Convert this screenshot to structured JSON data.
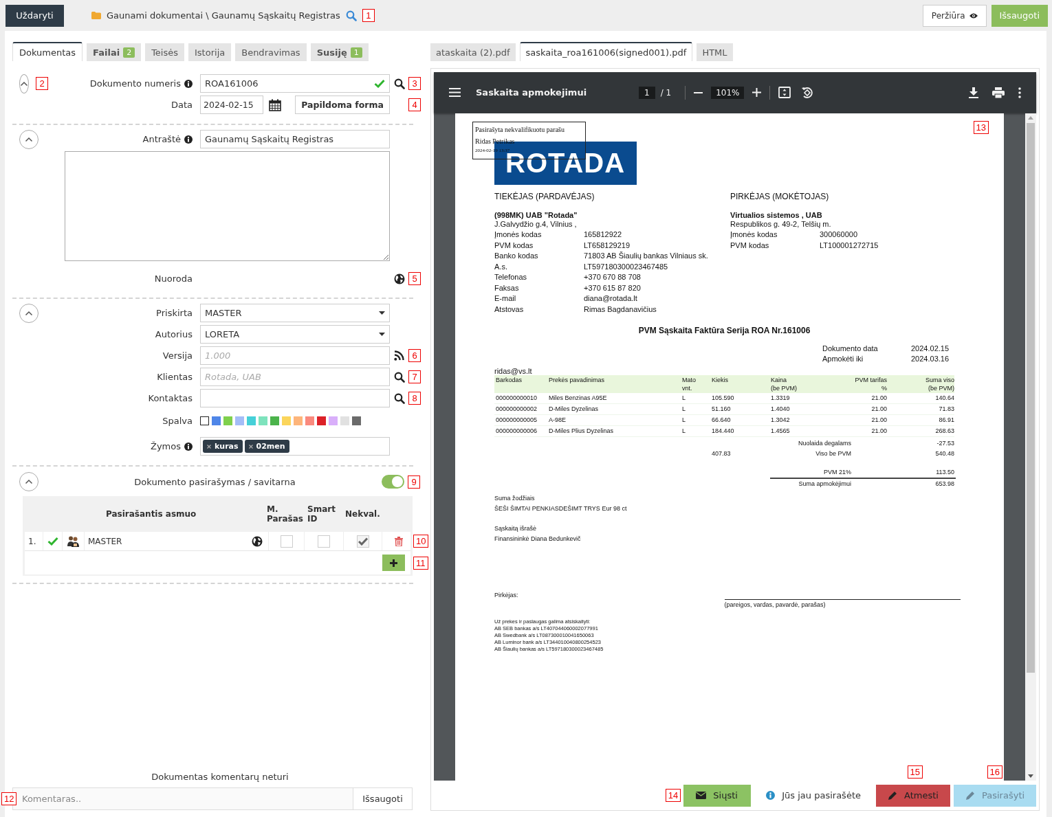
{
  "top_bar": {
    "close_button": "Uždaryti",
    "breadcrumb": "Gaunami dokumentai \\ Gaunamų Sąskaitų Registras",
    "preview_button": "Peržiūra",
    "save_button": "Išsaugoti"
  },
  "callouts": [
    "1",
    "2",
    "3",
    "4",
    "5",
    "6",
    "7",
    "8",
    "9",
    "10",
    "11",
    "12",
    "13",
    "14",
    "15",
    "16"
  ],
  "tabs": [
    {
      "label": "Dokumentas",
      "selected": true
    },
    {
      "label": "Failai",
      "badge": "2",
      "selected": false
    },
    {
      "label": "Teisės",
      "selected": false
    },
    {
      "label": "Istorija",
      "selected": false
    },
    {
      "label": "Bendravimas",
      "selected": false
    },
    {
      "label": "Susiję",
      "badge": "1",
      "selected": false
    }
  ],
  "document_number": {
    "label": "Dokumento numeris",
    "value": "ROA161006",
    "valid": true
  },
  "date": {
    "label": "Data",
    "value": "2024-02-15"
  },
  "extra_form_button": "Papildoma forma",
  "title_field": {
    "label": "Antraštė",
    "value": "Gaunamų Sąskaitų Registras"
  },
  "link_label": "Nuoroda",
  "fields": [
    {
      "kind": "select",
      "label": "Priskirta",
      "value": "MASTER"
    },
    {
      "kind": "select",
      "label": "Autorius",
      "value": "LORETA"
    },
    {
      "kind": "feed",
      "label": "Versija",
      "placeholder": "1.000"
    },
    {
      "kind": "lookup",
      "label": "Klientas",
      "placeholder": "Rotada, UAB"
    },
    {
      "kind": "lookup",
      "label": "Kontaktas"
    }
  ],
  "color_picker": {
    "label": "Spalva",
    "swatches": [
      {
        "color": "#ffffff"
      },
      {
        "color": "#4f86e8"
      },
      {
        "color": "#7fd04c"
      },
      {
        "color": "#a4bdf7"
      },
      {
        "color": "#46d0d8"
      },
      {
        "color": "#7ee3bd"
      },
      {
        "color": "#4bb34b"
      },
      {
        "color": "#fbd55b"
      },
      {
        "color": "#fdb57b"
      },
      {
        "color": "#fa8a7e"
      },
      {
        "color": "#dc2128"
      },
      {
        "color": "#d9affa"
      },
      {
        "color": "#e1e1e1"
      },
      {
        "color": "#6b6b6b"
      }
    ]
  },
  "tags": {
    "label": "Žymos",
    "items": [
      "kuras",
      "02men"
    ]
  },
  "signing": {
    "title": "Dokumento pasirašymas / savitarna",
    "enabled": true,
    "columns": [
      "Pasirašantis asmuo",
      "M. Parašas",
      "Smart ID",
      "Nekval."
    ],
    "rows": [
      {
        "index": "1.",
        "signed": true,
        "name": "MASTER",
        "m_signature": false,
        "smart_id": false,
        "unqualified": true
      }
    ]
  },
  "comments": {
    "empty_text": "Dokumentas komentarų neturi",
    "placeholder": "Komentaras..",
    "save_button": "Išsaugoti"
  },
  "file_tabs": [
    {
      "label": "ataskaita (2).pdf",
      "selected": false
    },
    {
      "label": "saskaita_roa161006(signed001).pdf",
      "selected": true
    },
    {
      "label": "HTML",
      "selected": false
    }
  ],
  "viewer": {
    "title": "Saskaita apmokejimui",
    "page": "1",
    "page_count": "/ 1",
    "zoom": "101%"
  },
  "document": {
    "stamp": [
      "Pasirašyta nekvalifikuotu parašu",
      "Ridas Petrikas",
      "2024-02-19 13:37"
    ],
    "logo": "ROTADA",
    "supplier": {
      "heading": "TIEKĖJAS (PARDAVĖJAS)",
      "name": "(998MK) UAB \"Rotada\"",
      "address": "J.Galvydžio g.4, Vilnius ,",
      "details": [
        {
          "key": "Įmonės kodas",
          "value": "165812922"
        },
        {
          "key": "PVM kodas",
          "value": "LT658129219"
        },
        {
          "key": "Banko kodas",
          "value": "71803 AB Šiaulių bankas Vilniaus sk."
        },
        {
          "key": "A.s.",
          "value": "LT597180300023467485"
        },
        {
          "key": "Telefonas",
          "value": "+370 670 88 708"
        },
        {
          "key": "Faksas",
          "value": "+370 615 87 820"
        },
        {
          "key": "E-mail",
          "value": "diana@rotada.lt"
        },
        {
          "key": "Atstovas",
          "value": "Rimas Bagdanavičius"
        }
      ]
    },
    "buyer": {
      "heading": "PIRKĖJAS (MOKĖTOJAS)",
      "name": "Virtualios sistemos , UAB",
      "address": "Respublikos g. 49-2, Telšių m.",
      "details": [
        {
          "key": "Įmonės kodas",
          "value": "300060000"
        },
        {
          "key": "PVM kodas",
          "value": "LT100001272715"
        }
      ]
    },
    "title": "PVM Sąskaita Faktūra Serija ROA Nr.161006",
    "dates": [
      {
        "key": "Dokumento data",
        "value": "2024.02.15"
      },
      {
        "key": "Apmokėti iki",
        "value": "2024.03.16"
      }
    ],
    "email": "ridas@vs.lt",
    "columns": [
      "Barkodas",
      "Prekės pavadinimas",
      "Mato\nvnt.",
      "Kiekis",
      "Kaina\n(be PVM)",
      "PVM tarifas\n%",
      "Suma viso\n(be PVM)"
    ],
    "rows": [
      [
        "000000000010",
        "Miles Benzinas A95E",
        "L",
        "105.590",
        "1.3319",
        "21.00",
        "140.64"
      ],
      [
        "000000000002",
        "D-Miles Dyzelinas",
        "L",
        "51.160",
        "1.4040",
        "21.00",
        "71.83"
      ],
      [
        "000000000005",
        "A-98E",
        "L",
        "66.640",
        "1.3042",
        "21.00",
        "86.91"
      ],
      [
        "000000000006",
        "D-Miles Plius Dyzelinas",
        "L",
        "184.440",
        "1.4565",
        "21.00",
        "268.63"
      ]
    ],
    "totals": [
      {
        "kind": "discount",
        "label": "Nuolaida degalams",
        "value": "-27.53"
      },
      {
        "kind": "subtotal",
        "quantity": "407.83",
        "label": "Viso be PVM",
        "value": "540.48"
      },
      {
        "kind": "vat",
        "label": "PVM 21%",
        "value": "113.50"
      },
      {
        "kind": "total",
        "label": "Suma apmokėjimui",
        "value": "653.98"
      }
    ],
    "amount_in_words": {
      "label": "Suma žodžiais",
      "value": "ŠEŠI ŠIMTAI PENKIASDEŠIMT TRYS Eur 98 ct"
    },
    "issuer": {
      "label": "Sąskaitą išrašė",
      "value": "Finansininkė Diana Bedunkevič"
    },
    "buyer_signature": {
      "label": "Pirkėjas:",
      "caption": "(pareigos, vardas, pavardė, parašas)"
    },
    "payment_note": [
      "Už prekes ir paslaugas galima atsiskaityti:",
      "AB SEB bankas a/s LT407044060002077991",
      "AB Swedbank a/s LT087300010041650063",
      "AB Luminor bank a/s LT344010040800254523",
      "AB Šiaulių bankas a/s LT597180300023467485"
    ]
  },
  "actions": {
    "send_button": "Siųsti",
    "signed_notice": "Jūs jau pasirašėte",
    "reject_button": "Atmesti",
    "sign_button": {
      "label": "Pasirašyti",
      "disabled": true
    }
  }
}
